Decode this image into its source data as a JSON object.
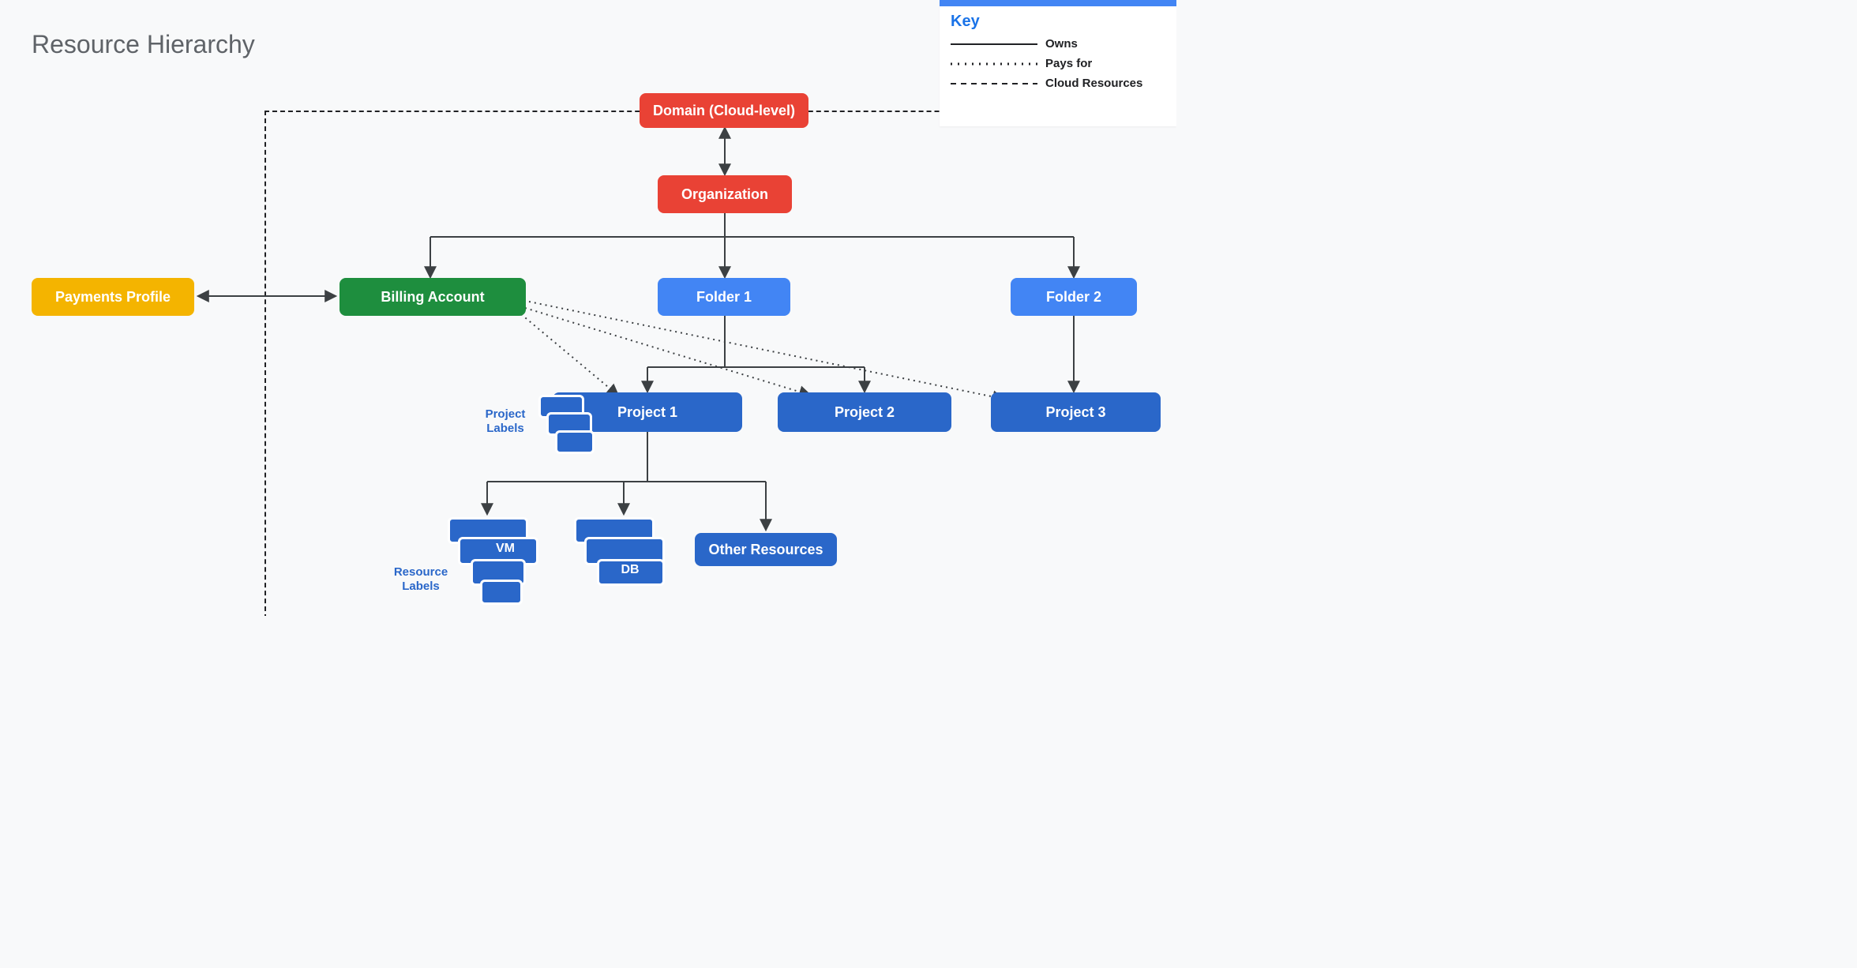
{
  "title": "Resource Hierarchy",
  "legend": {
    "title": "Key",
    "rows": [
      {
        "label": "Owns",
        "style": "solid"
      },
      {
        "label": "Pays for",
        "style": "dotted"
      },
      {
        "label": "Cloud Resources",
        "style": "dashed"
      }
    ]
  },
  "nodes": {
    "domain": {
      "label": "Domain (Cloud-level)",
      "color": "red"
    },
    "organization": {
      "label": "Organization",
      "color": "red"
    },
    "payments_profile": {
      "label": "Payments Profile",
      "color": "yellow"
    },
    "billing_account": {
      "label": "Billing Account",
      "color": "green"
    },
    "folder1": {
      "label": "Folder 1",
      "color": "blue"
    },
    "folder2": {
      "label": "Folder 2",
      "color": "blue"
    },
    "project1": {
      "label": "Project 1",
      "color": "dblue"
    },
    "project2": {
      "label": "Project 2",
      "color": "dblue"
    },
    "project3": {
      "label": "Project 3",
      "color": "dblue"
    },
    "other_resources": {
      "label": "Other Resources",
      "color": "dblue"
    }
  },
  "labels": {
    "project_labels": "Project\nLabels",
    "resource_labels": "Resource\nLabels"
  },
  "stacks": {
    "vm": "VM",
    "db": "DB"
  },
  "edges": {
    "owns": [
      [
        "domain",
        "organization",
        "double"
      ],
      [
        "organization",
        "billing_account",
        "down"
      ],
      [
        "organization",
        "folder1",
        "down"
      ],
      [
        "organization",
        "folder2",
        "down"
      ],
      [
        "billing_account",
        "payments_profile",
        "double-horiz"
      ],
      [
        "folder1",
        "project1",
        "down"
      ],
      [
        "folder1",
        "project2",
        "down"
      ],
      [
        "folder2",
        "project3",
        "down"
      ],
      [
        "project1",
        "vm",
        "down"
      ],
      [
        "project1",
        "db",
        "down"
      ],
      [
        "project1",
        "other_resources",
        "down"
      ]
    ],
    "pays_for": [
      [
        "billing_account",
        "project1"
      ],
      [
        "billing_account",
        "project2"
      ],
      [
        "billing_account",
        "project3"
      ]
    ]
  }
}
